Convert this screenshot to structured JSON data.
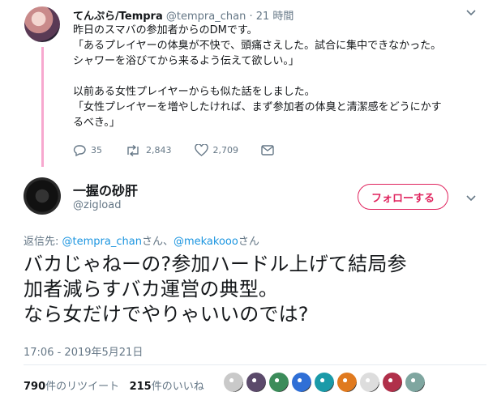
{
  "parent": {
    "name": "てんぷら/Tempra",
    "handle": "@tempra_chan",
    "time": "21 時間",
    "text": "昨日のスマバの参加者からのDMです。\n「あるプレイヤーの体臭が不快で、頭痛さえした。試合に集中できなかった。\nシャワーを浴びてから来るよう伝えて欲しい。」\n\n以前ある女性プレイヤーからも似た話をしました。\n「女性プレイヤーを増やしたければ、まず参加者の体臭と清潔感をどうにかす\nるべき。」",
    "actions": {
      "replies": "35",
      "retweets": "2,843",
      "likes": "2,709"
    }
  },
  "reply": {
    "name": "一握の砂肝",
    "handle": "@zigload",
    "follow_label": "フォローする",
    "replying_prefix": "返信先: ",
    "replying_user1": "@tempra_chan",
    "replying_sep": "さん、",
    "replying_user2": "@mekakooo",
    "replying_suffix": "さん",
    "text": "バカじゃねーの?参加ハードル上げて結局参\n加者減らすバカ運営の典型。\nなら女だけでやりゃいいのでは?",
    "timestamp": "17:06 - 2019年5月21日",
    "retweet_count": "790",
    "retweet_label": "件のリツイート",
    "like_count": "215",
    "like_label": "件のいいね"
  },
  "colors": {
    "accent_pink": "#e0245e",
    "thread_line": "#f7a8cf",
    "link": "#1b95e0",
    "muted": "#657786"
  },
  "liker_avatars": [
    "#c9c9c9",
    "#5b4a6b",
    "#3c8c5a",
    "#2f6fd6",
    "#1a9aa8",
    "#e07a1f",
    "#dddddd",
    "#b0304a",
    "#7fa6a0"
  ]
}
